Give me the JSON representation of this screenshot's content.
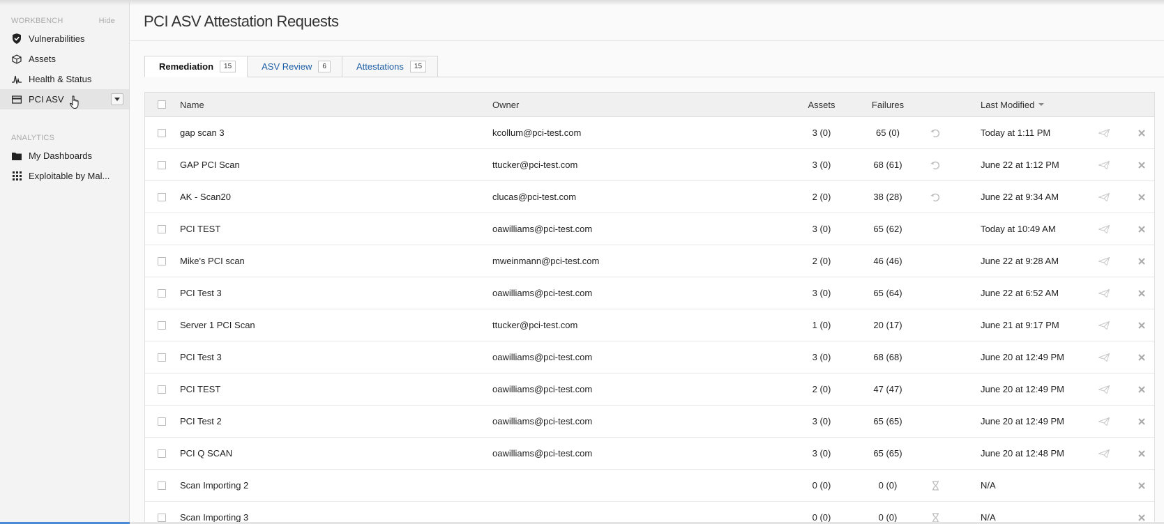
{
  "sidebar": {
    "workbench_header": "WORKBENCH",
    "hide_label": "Hide",
    "items": [
      {
        "label": "Vulnerabilities",
        "icon": "shield-icon"
      },
      {
        "label": "Assets",
        "icon": "cube-icon"
      },
      {
        "label": "Health & Status",
        "icon": "pulse-icon"
      },
      {
        "label": "PCI ASV",
        "icon": "card-icon"
      }
    ],
    "analytics_header": "ANALYTICS",
    "analytics_items": [
      {
        "label": "My Dashboards",
        "icon": "folder-icon"
      },
      {
        "label": "Exploitable by Mal...",
        "icon": "grid-icon"
      }
    ]
  },
  "page": {
    "title": "PCI ASV Attestation Requests"
  },
  "tabs": [
    {
      "label": "Remediation",
      "count": "15"
    },
    {
      "label": "ASV Review",
      "count": "6"
    },
    {
      "label": "Attestations",
      "count": "15"
    }
  ],
  "table": {
    "columns": {
      "name": "Name",
      "owner": "Owner",
      "assets": "Assets",
      "failures": "Failures",
      "modified": "Last Modified"
    },
    "rows": [
      {
        "name": "gap scan 3",
        "owner": "kcollum@pci-test.com",
        "assets": "3 (0)",
        "failures": "65 (0)",
        "modified": "Today at 1:11 PM",
        "status": "undo"
      },
      {
        "name": "GAP PCI Scan",
        "owner": "ttucker@pci-test.com",
        "assets": "3 (0)",
        "failures": "68 (61)",
        "modified": "June 22 at 1:12 PM",
        "status": "undo"
      },
      {
        "name": "AK - Scan20",
        "owner": "clucas@pci-test.com",
        "assets": "2 (0)",
        "failures": "38 (28)",
        "modified": "June 22 at 9:34 AM",
        "status": "undo"
      },
      {
        "name": "PCI TEST",
        "owner": "oawilliams@pci-test.com",
        "assets": "3 (0)",
        "failures": "65 (62)",
        "modified": "Today at 10:49 AM",
        "status": ""
      },
      {
        "name": "Mike's PCI scan",
        "owner": "mweinmann@pci-test.com",
        "assets": "2 (0)",
        "failures": "46 (46)",
        "modified": "June 22 at 9:28 AM",
        "status": ""
      },
      {
        "name": "PCI Test 3",
        "owner": "oawilliams@pci-test.com",
        "assets": "3 (0)",
        "failures": "65 (64)",
        "modified": "June 22 at 6:52 AM",
        "status": ""
      },
      {
        "name": "Server 1 PCI Scan",
        "owner": "ttucker@pci-test.com",
        "assets": "1 (0)",
        "failures": "20 (17)",
        "modified": "June 21 at 9:17 PM",
        "status": ""
      },
      {
        "name": "PCI Test 3",
        "owner": "oawilliams@pci-test.com",
        "assets": "3 (0)",
        "failures": "68 (68)",
        "modified": "June 20 at 12:49 PM",
        "status": ""
      },
      {
        "name": "PCI TEST",
        "owner": "oawilliams@pci-test.com",
        "assets": "2 (0)",
        "failures": "47 (47)",
        "modified": "June 20 at 12:49 PM",
        "status": ""
      },
      {
        "name": "PCI Test 2",
        "owner": "oawilliams@pci-test.com",
        "assets": "3 (0)",
        "failures": "65 (65)",
        "modified": "June 20 at 12:49 PM",
        "status": ""
      },
      {
        "name": "PCI Q SCAN",
        "owner": "oawilliams@pci-test.com",
        "assets": "3 (0)",
        "failures": "65 (65)",
        "modified": "June 20 at 12:48 PM",
        "status": ""
      },
      {
        "name": "Scan Importing 2",
        "owner": "",
        "assets": "0 (0)",
        "failures": "0 (0)",
        "modified": "N/A",
        "status": "pending"
      },
      {
        "name": "Scan Importing 3",
        "owner": "",
        "assets": "0 (0)",
        "failures": "0 (0)",
        "modified": "N/A",
        "status": "pending"
      }
    ]
  },
  "colors": {
    "link": "#1f5fa5",
    "accent": "#4b8bd6"
  }
}
